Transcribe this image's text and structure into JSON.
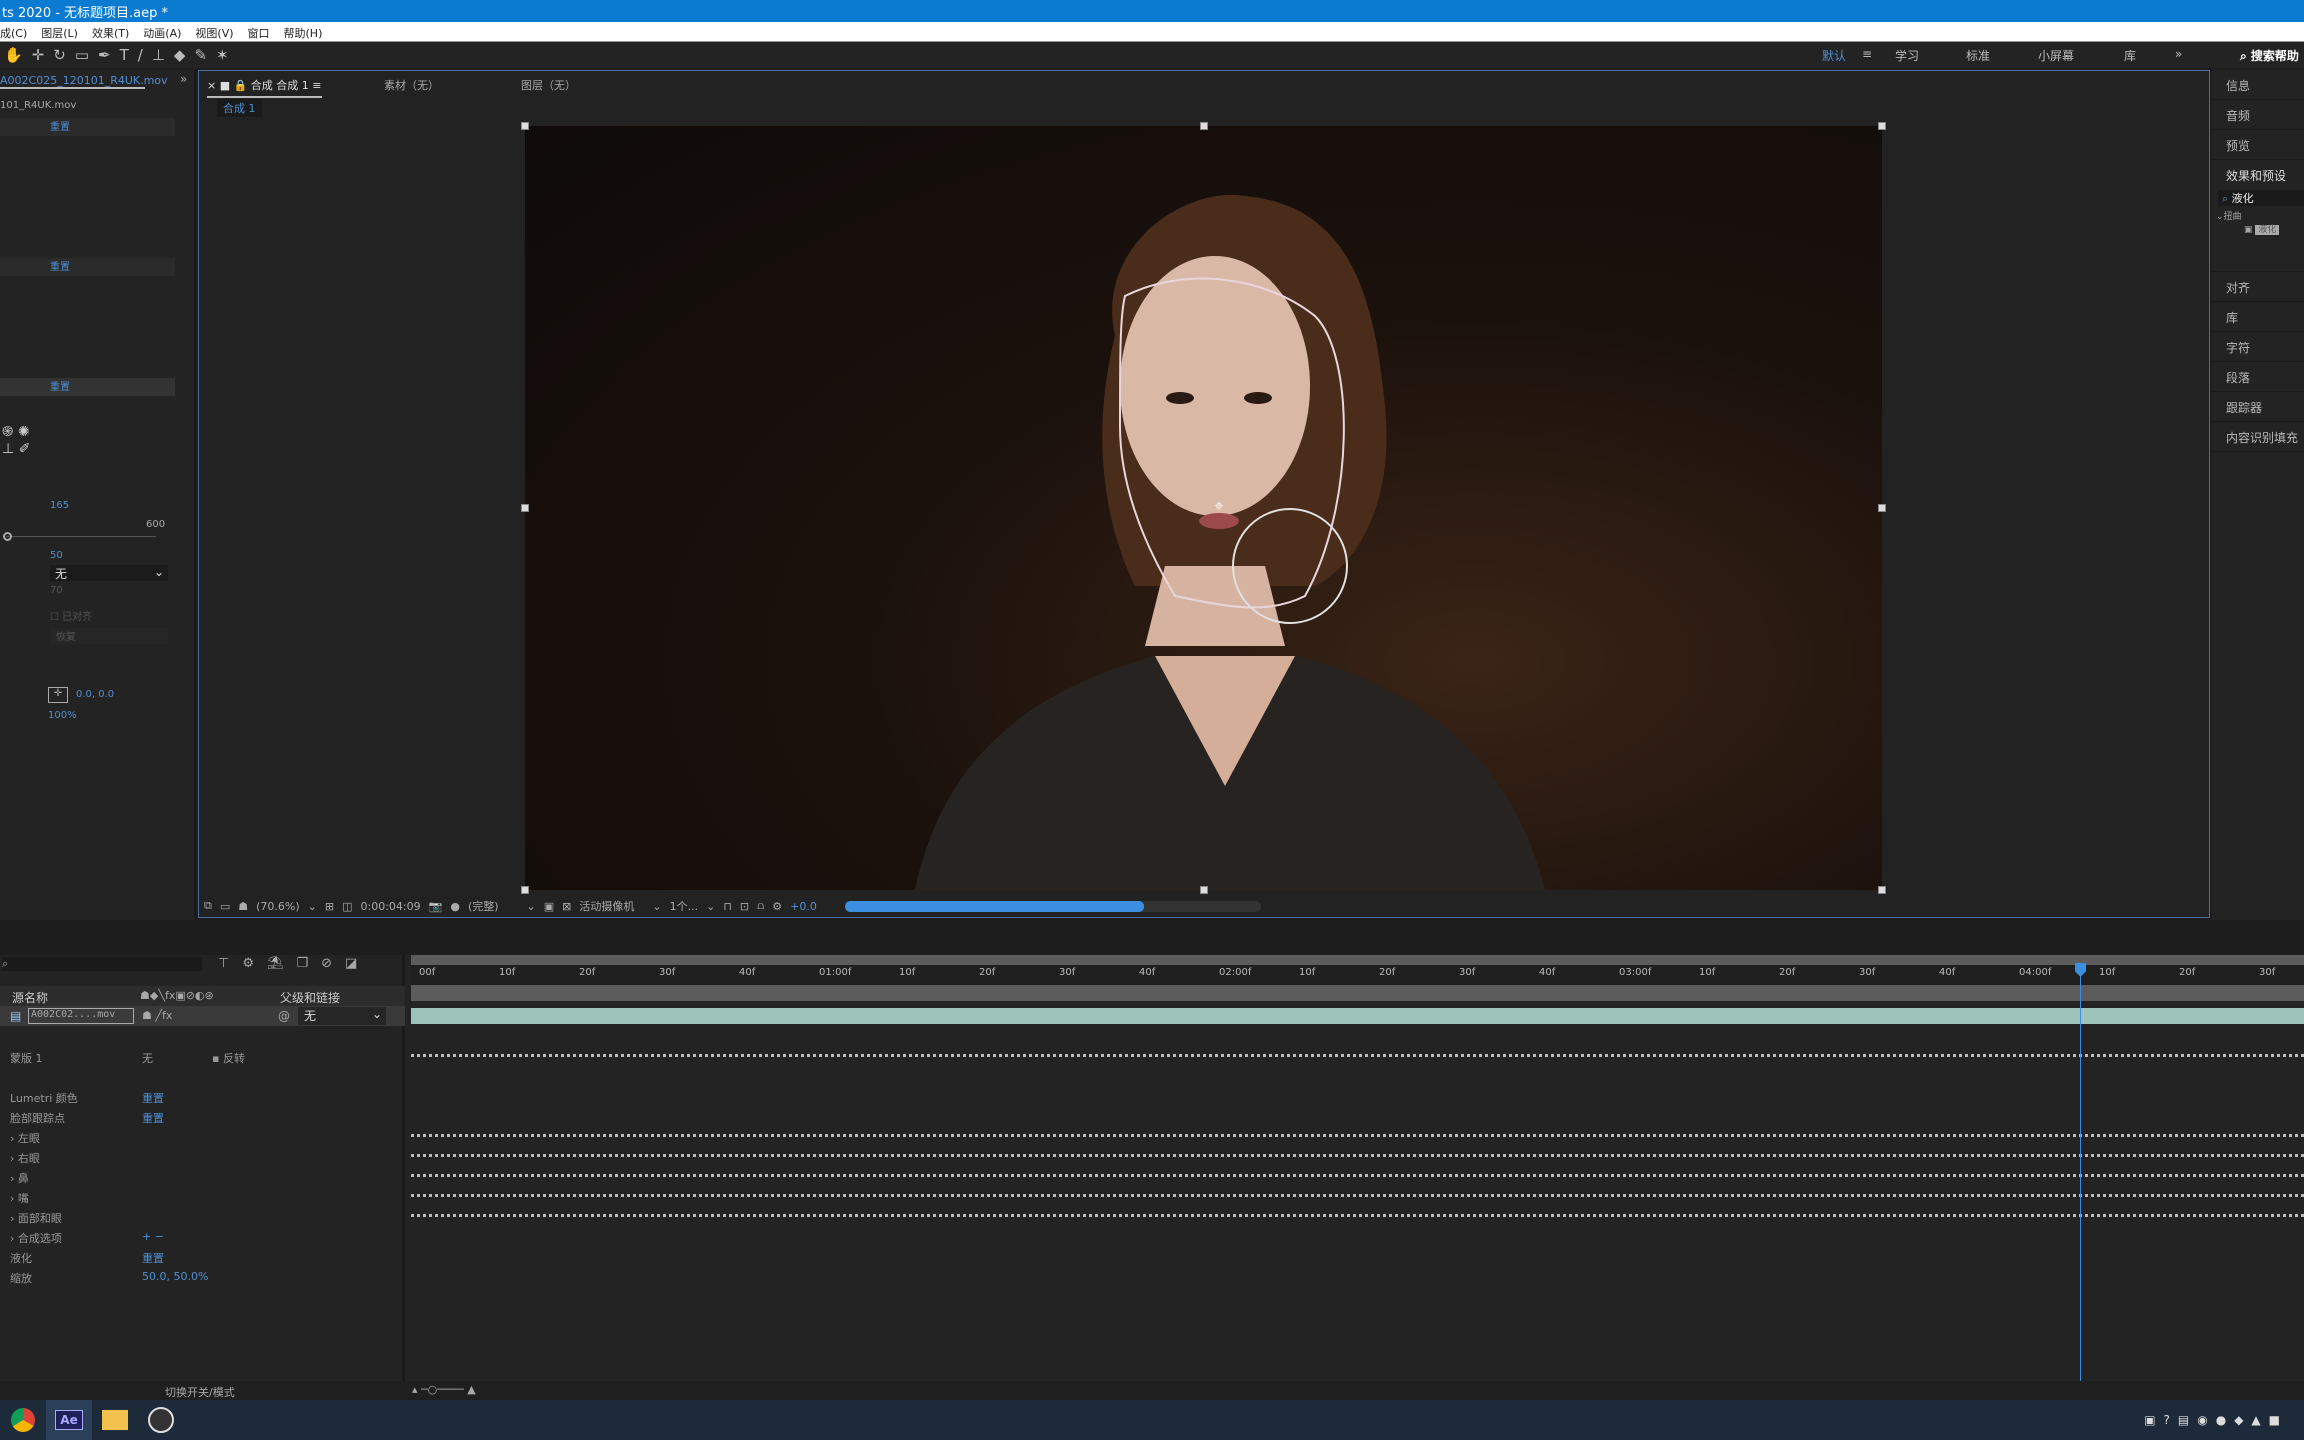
{
  "window": {
    "title": "ts 2020 - 无标题项目.aep *"
  },
  "menu": [
    "成(C)",
    "图层(L)",
    "效果(T)",
    "动画(A)",
    "视图(V)",
    "窗口",
    "帮助(H)"
  ],
  "workspaces": {
    "active": "默认",
    "items": [
      "学习",
      "标准",
      "小屏幕",
      "库"
    ],
    "search": "搜索帮助"
  },
  "left_panel": {
    "tab": "A002C025_120101_R4UK.mov",
    "subtitle": "101_R4UK.mov",
    "reset": "重置",
    "value1": "165",
    "slider_max": "600",
    "value2": "50",
    "dropdown": "无",
    "value3": "70",
    "checkbox_label": "已对齐",
    "dropdown2": "恢复",
    "position": "0.0, 0.0",
    "scale": "100%"
  },
  "comp": {
    "tabs": [
      {
        "label": "合成 合成 1"
      },
      {
        "label": "素材（无）"
      },
      {
        "label": "图层（无）"
      }
    ],
    "subtab": "合成 1"
  },
  "viewer_toolbar": {
    "zoom": "(70.6%)",
    "timecode": "0:00:04:09",
    "resolution": "(完整)",
    "camera": "活动摄像机",
    "views": "1个...",
    "exposure": "+0.0",
    "render_progress": 0.72
  },
  "right_panel": {
    "items": [
      "信息",
      "音频",
      "预览",
      "效果和预设"
    ],
    "search": "液化",
    "category": "扭曲",
    "result": "液化",
    "items2": [
      "对齐",
      "库",
      "字符",
      "段落",
      "跟踪器",
      "内容识别填充"
    ]
  },
  "timeline": {
    "headers": {
      "source": "源名称",
      "parent": "父级和链接"
    },
    "layer": {
      "name": "A002C02....mov",
      "parent": "无"
    },
    "rows": [
      {
        "label": "",
        "value": ""
      },
      {
        "label": "蒙版 1",
        "value": "无",
        "extra": "反转",
        "keys": true
      },
      {
        "label": "",
        "value": ""
      },
      {
        "label": "Lumetri 颜色",
        "value": "重置"
      },
      {
        "label": "脸部跟踪点",
        "value": "重置"
      },
      {
        "label": "› 左眼",
        "keys": true
      },
      {
        "label": "› 右眼",
        "keys": true
      },
      {
        "label": "› 鼻",
        "keys": true
      },
      {
        "label": "› 嘴",
        "keys": true
      },
      {
        "label": "› 面部和眼",
        "keys": true
      },
      {
        "label": "› 合成选项",
        "value": "+ −"
      },
      {
        "label": "液化",
        "value": "重置"
      },
      {
        "label": "缩放",
        "value": "50.0, 50.0%"
      }
    ],
    "ruler": [
      "00f",
      "10f",
      "20f",
      "30f",
      "40f",
      "01:00f",
      "10f",
      "20f",
      "30f",
      "40f",
      "02:00f",
      "10f",
      "20f",
      "30f",
      "40f",
      "03:00f",
      "10f",
      "20f",
      "30f",
      "40f",
      "04:00f",
      "10f",
      "20f",
      "30f"
    ],
    "playhead_time": "0:00:04:09",
    "footer": "切换开关/模式"
  },
  "taskbar": [
    "chrome",
    "Ae",
    "folder",
    "obs"
  ],
  "colors": {
    "accent": "#4f8fd6",
    "titlebar": "#0a7bd1",
    "layerbar": "#9ec3bb"
  }
}
